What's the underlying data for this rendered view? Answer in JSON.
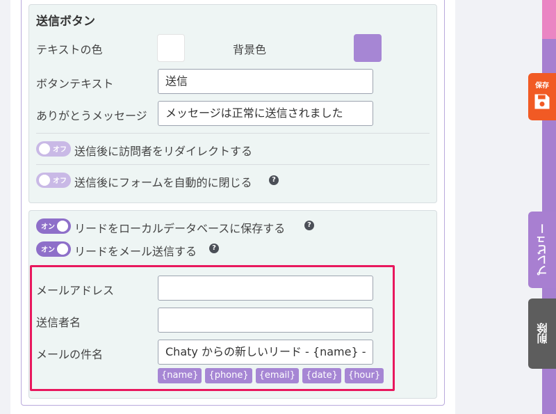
{
  "submit_section": {
    "title": "送信ボタン",
    "text_color_label": "テキストの色",
    "text_color": "#ffffff",
    "bg_color_label": "背景色",
    "bg_color": "#a686d4",
    "button_text_label": "ボタンテキスト",
    "button_text_value": "送信",
    "thank_you_label": "ありがとうメッセージ",
    "thank_you_value": "メッセージは正常に送信されました",
    "redirect_toggle": {
      "state_label": "オフ",
      "label": "送信後に訪問者をリダイレクトする"
    },
    "autoclose_toggle": {
      "state_label": "オフ",
      "label": "送信後にフォームを自動的に閉じる"
    }
  },
  "leads_section": {
    "save_db_toggle": {
      "state_label": "オン",
      "label": "リードをローカルデータベースに保存する"
    },
    "send_email_toggle": {
      "state_label": "オン",
      "label": "リードをメール送信する"
    },
    "email_address_label": "メールアドレス",
    "email_address_value": "",
    "sender_name_label": "送信者名",
    "sender_name_value": "",
    "subject_label": "メールの件名",
    "subject_value": "Chaty からの新しいリード - {name} -",
    "tags": [
      "{name}",
      "{phone}",
      "{email}",
      "{date}",
      "{hour}"
    ]
  },
  "side_actions": {
    "save_label": "保存",
    "preview_label": "プレビュー",
    "delete_label": "削除"
  },
  "colors": {
    "accent": "#a686d4",
    "highlight": "#e8175d",
    "save": "#f15a24"
  }
}
